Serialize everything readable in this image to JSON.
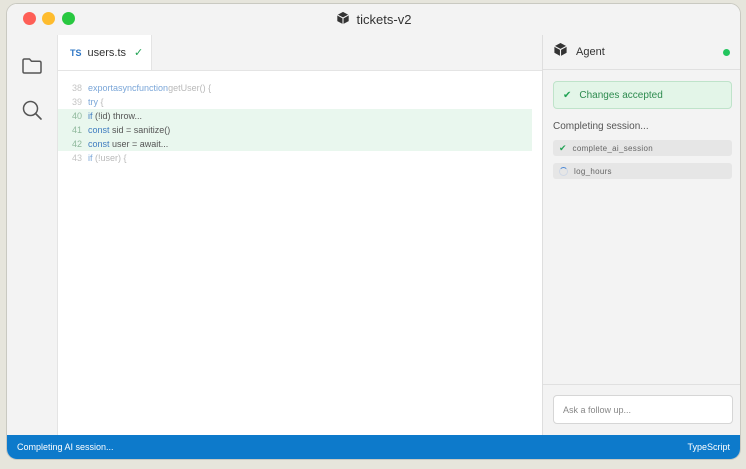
{
  "window": {
    "title": "tickets-v2"
  },
  "colors": {
    "accent": "#0d7acb",
    "success": "#22a355",
    "added_line_bg": "#e9f7ee"
  },
  "activity_bar": {
    "icons": [
      "folder-icon",
      "search-icon"
    ]
  },
  "editor": {
    "tab": {
      "lang_badge": "TS",
      "filename": "users.ts",
      "status_mark": "✓"
    },
    "lines": [
      {
        "num": "38",
        "added": false,
        "tokens": [
          {
            "t": "export",
            "k": true
          },
          {
            "t": "async",
            "k": true
          },
          {
            "t": "function",
            "k": true
          },
          {
            "t": "getUser() {",
            "k": false
          }
        ]
      },
      {
        "num": "39",
        "added": false,
        "tokens": [
          {
            "t": "try",
            "k": true
          },
          {
            "t": " {",
            "k": false
          }
        ]
      },
      {
        "num": "40",
        "added": true,
        "tokens": [
          {
            "t": "if",
            "k": true
          },
          {
            "t": " (!id) throw...",
            "k": false
          }
        ]
      },
      {
        "num": "41",
        "added": true,
        "tokens": [
          {
            "t": "const",
            "k": true
          },
          {
            "t": " sid = sanitize()",
            "k": false
          }
        ]
      },
      {
        "num": "42",
        "added": true,
        "tokens": [
          {
            "t": "const",
            "k": true
          },
          {
            "t": " user = await...",
            "k": false
          }
        ]
      },
      {
        "num": "43",
        "added": false,
        "tokens": [
          {
            "t": "if",
            "k": true
          },
          {
            "t": " (!user) {",
            "k": false
          }
        ]
      }
    ]
  },
  "agent": {
    "title": "Agent",
    "accepted_label": "Changes accepted",
    "status_text": "Completing session...",
    "steps": [
      {
        "label": "complete_ai_session",
        "state": "done"
      },
      {
        "label": "log_hours",
        "state": "running"
      }
    ],
    "followup_placeholder": "Ask a follow up..."
  },
  "statusbar": {
    "left": "Completing AI session...",
    "right": "TypeScript"
  }
}
